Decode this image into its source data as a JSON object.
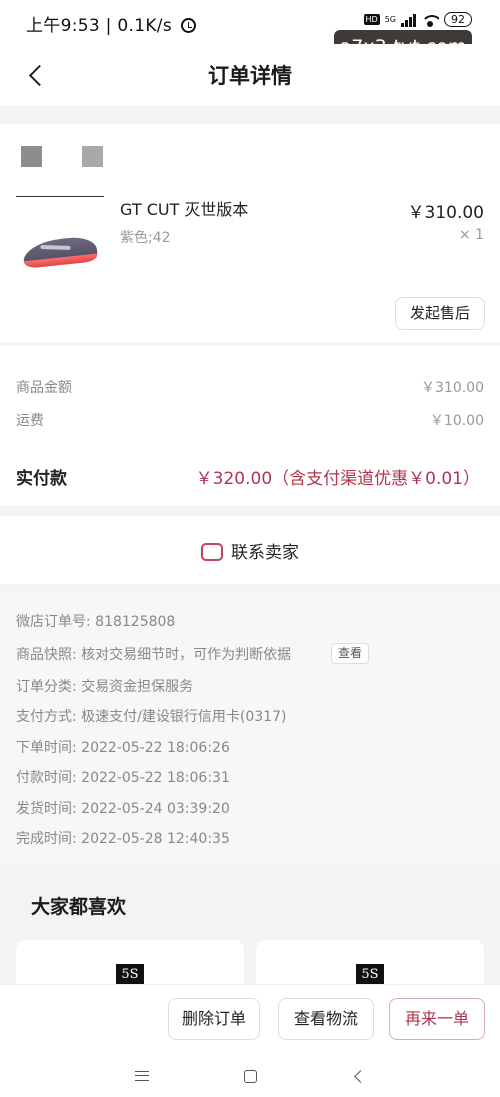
{
  "status_bar": {
    "time_text": "上午9:53 | 0.1K/s",
    "hd": "HD",
    "network": "5G",
    "battery": "92"
  },
  "watermark": "a7x3-tvt.com",
  "header": {
    "title": "订单详情"
  },
  "product": {
    "name": "GT CUT 灭世版本",
    "variant": "紫色;42",
    "price": "￥310.00",
    "quantity": "× 1",
    "after_sale_label": "发起售后"
  },
  "amounts": {
    "goods_label": "商品金额",
    "goods_value": "￥310.00",
    "shipping_label": "运费",
    "shipping_value": "￥10.00",
    "paid_label": "实付款",
    "paid_value": "￥320.00（含支付渠道优惠￥0.01）"
  },
  "contact": {
    "label": "联系卖家"
  },
  "order_info": {
    "rows": [
      {
        "label": "微店订单号:",
        "value": "818125808"
      },
      {
        "label": "商品快照:",
        "value": "核对交易细节时，可作为判断依据"
      },
      {
        "label": "订单分类:",
        "value": "交易资金担保服务"
      },
      {
        "label": "支付方式:",
        "value": "极速支付/建设银行信用卡(0317)"
      },
      {
        "label": "下单时间:",
        "value": "2022-05-22 18:06:26"
      },
      {
        "label": "付款时间:",
        "value": "2022-05-22 18:06:31"
      },
      {
        "label": "发货时间:",
        "value": "2022-05-24 03:39:20"
      },
      {
        "label": "完成时间:",
        "value": "2022-05-28 12:40:35"
      }
    ],
    "view_label": "查看"
  },
  "recommend": {
    "title": "大家都喜欢",
    "logo_text": "5S"
  },
  "actions": {
    "delete": "删除订单",
    "logistics": "查看物流",
    "rebuy": "再来一单"
  },
  "colors": {
    "accent": "#b0364e",
    "muted_text": "#888888",
    "background": "#f5f5f5"
  },
  "icons": [
    "alarm-icon",
    "signal-icon",
    "wifi-icon",
    "battery-icon",
    "back-icon",
    "chat-icon",
    "menu-icon",
    "home-icon",
    "nav-back-icon"
  ]
}
